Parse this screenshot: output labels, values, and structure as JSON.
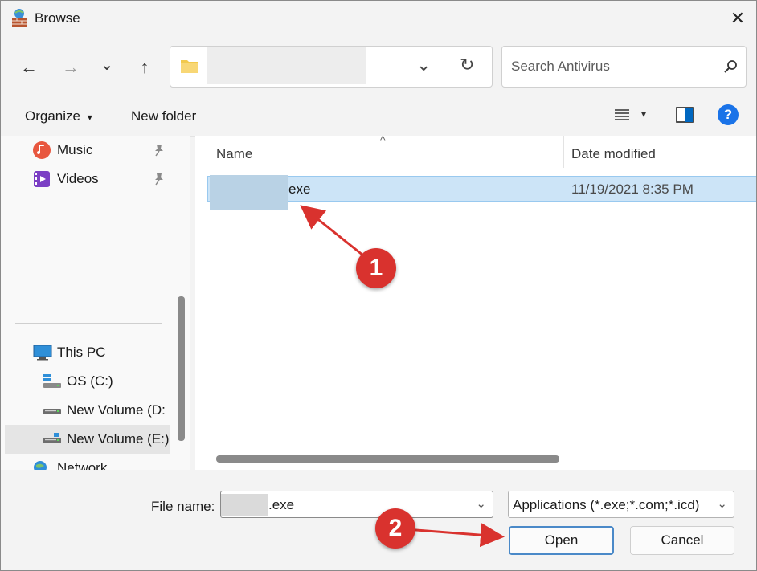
{
  "window": {
    "title": "Browse",
    "close_glyph": "✕"
  },
  "navigation": {
    "back_glyph": "←",
    "forward_glyph": "→",
    "recent_glyph": "⌄",
    "up_glyph": "↑",
    "address_path": "",
    "address_dropdown_glyph": "⌄",
    "refresh_glyph": "↻"
  },
  "search": {
    "placeholder": "Search Antivirus"
  },
  "command_bar": {
    "organize_label": "Organize",
    "organize_caret": "▾",
    "new_folder_label": "New folder",
    "view_menu_caret": "▾",
    "help_glyph": "?"
  },
  "sidebar": {
    "items": [
      {
        "label": "Music",
        "icon": "music-icon",
        "pinned": true
      },
      {
        "label": "Videos",
        "icon": "videos-icon",
        "pinned": true
      },
      {
        "label": "This PC",
        "icon": "this-pc-icon"
      },
      {
        "label": "OS (C:)",
        "icon": "os-drive-icon"
      },
      {
        "label": "New Volume (D:",
        "icon": "drive-icon"
      },
      {
        "label": "New Volume (E:)",
        "icon": "drive-icon",
        "selected": true
      },
      {
        "label": "Network",
        "icon": "network-icon"
      }
    ]
  },
  "file_list": {
    "columns": [
      "Name",
      "Date modified"
    ],
    "sort_indicator": "^",
    "rows": [
      {
        "name": "exe",
        "date_modified": "11/19/2021 8:35 PM",
        "selected": true
      }
    ]
  },
  "footer": {
    "file_name_label": "File name:",
    "file_name_value": ".exe",
    "file_name_dropdown_glyph": "⌄",
    "file_type_value": "Applications (*.exe;*.com;*.icd)",
    "file_type_dropdown_glyph": "⌄",
    "open_label": "Open",
    "cancel_label": "Cancel"
  },
  "annotations": {
    "step1": "1",
    "step2": "2",
    "color": "#d9322e"
  },
  "colors": {
    "accent": "#0067c0",
    "selection": "#cce4f7",
    "help_blue": "#1a73e8"
  }
}
